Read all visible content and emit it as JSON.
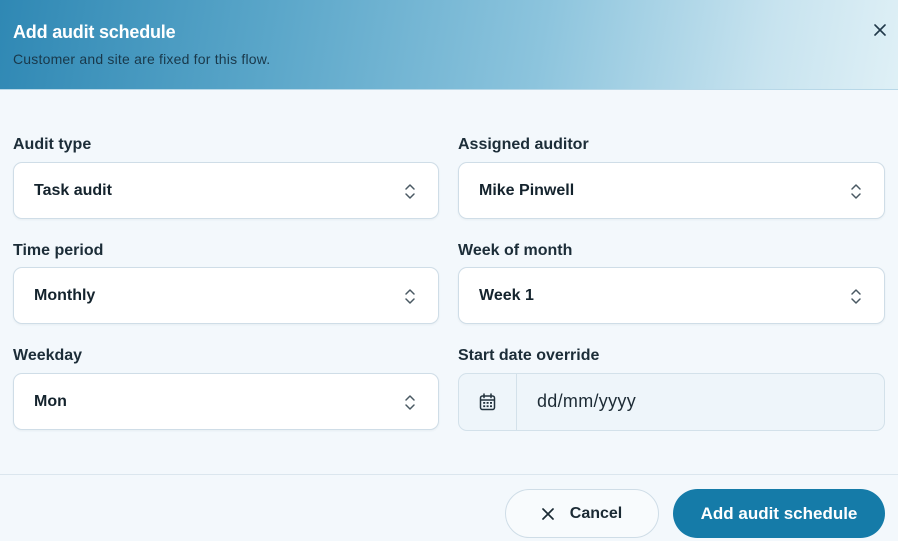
{
  "dialog": {
    "title": "Add audit schedule",
    "subtitle": "Customer and site are fixed for this flow.",
    "close_icon": "close-icon"
  },
  "form": {
    "audit_type": {
      "label": "Audit type",
      "value": "Task audit"
    },
    "assigned_auditor": {
      "label": "Assigned auditor",
      "value": "Mike Pinwell"
    },
    "time_period": {
      "label": "Time period",
      "value": "Monthly"
    },
    "week_of_month": {
      "label": "Week of month",
      "value": "Week 1"
    },
    "weekday": {
      "label": "Weekday",
      "value": "Mon"
    },
    "start_date_override": {
      "label": "Start date override",
      "placeholder": "dd/mm/yyyy",
      "icon": "calendar-icon"
    }
  },
  "footer": {
    "cancel_label": "Cancel",
    "submit_label": "Add audit schedule"
  },
  "colors": {
    "primary": "#157ba8",
    "header_gradient_start": "#2f88b4",
    "header_gradient_end": "#dff0f6",
    "background": "#f3f8fc"
  }
}
